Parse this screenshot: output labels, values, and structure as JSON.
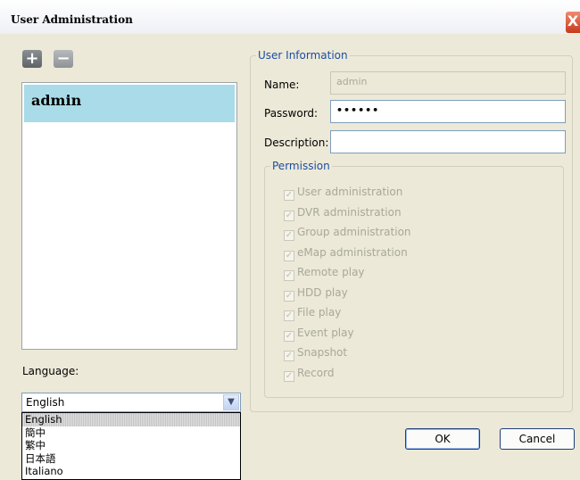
{
  "window": {
    "title": "User Administration",
    "close_symbol": "X"
  },
  "toolbar": {
    "add_symbol": "+",
    "remove_symbol": "−"
  },
  "users": [
    {
      "name": "admin",
      "selected": true
    }
  ],
  "language": {
    "label": "Language:",
    "selected": "English",
    "options": [
      "English",
      "簡中",
      "繁中",
      "日本語",
      "Italiano"
    ]
  },
  "user_info": {
    "legend": "User Information",
    "name_label": "Name:",
    "name_value": "admin",
    "password_label": "Password:",
    "password_value": "••••••",
    "description_label": "Description:",
    "description_value": ""
  },
  "permission": {
    "legend": "Permission",
    "items": [
      {
        "label": "User administration",
        "checked": true,
        "enabled": false
      },
      {
        "label": "DVR administration",
        "checked": true,
        "enabled": false
      },
      {
        "label": "Group administration",
        "checked": true,
        "enabled": false
      },
      {
        "label": "eMap administration",
        "checked": true,
        "enabled": false
      },
      {
        "label": "Remote play",
        "checked": true,
        "enabled": false
      },
      {
        "label": "HDD play",
        "checked": true,
        "enabled": false
      },
      {
        "label": "File play",
        "checked": true,
        "enabled": false
      },
      {
        "label": "Event play",
        "checked": true,
        "enabled": false
      },
      {
        "label": "Snapshot",
        "checked": true,
        "enabled": false
      },
      {
        "label": "Record",
        "checked": true,
        "enabled": false
      }
    ]
  },
  "buttons": {
    "ok": "OK",
    "cancel": "Cancel"
  }
}
